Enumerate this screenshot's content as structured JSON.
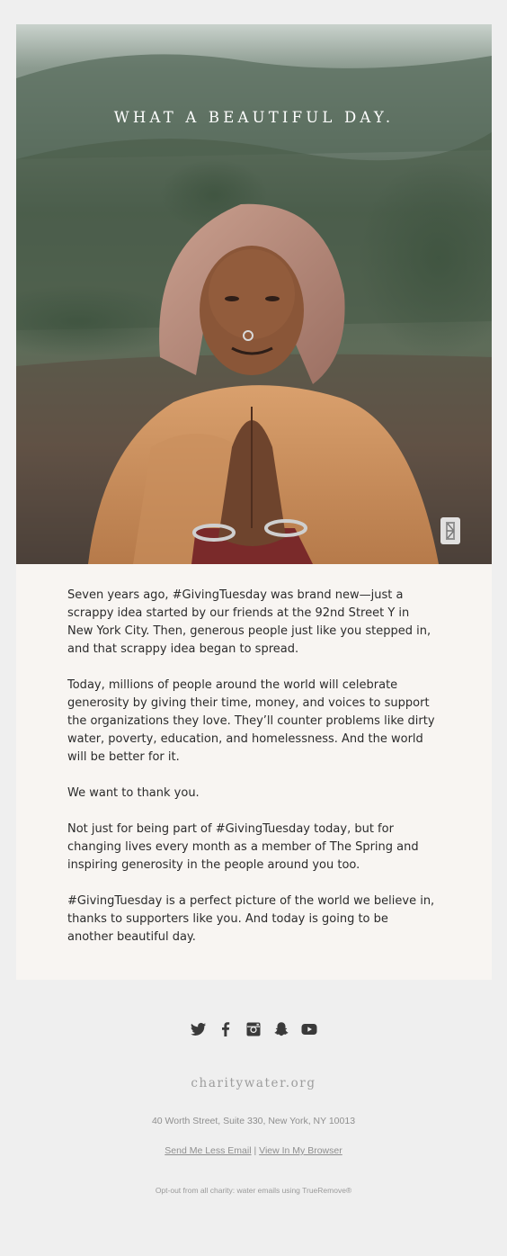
{
  "hero": {
    "title": "WHAT A BEAUTIFUL DAY.",
    "badge_icon": "charity-water-jerrycan-icon"
  },
  "body": {
    "paragraphs": [
      "Seven years ago, #GivingTuesday was brand new—just a scrappy idea started by our friends at the 92nd Street Y in New York City. Then, generous people just like you stepped in, and that scrappy idea began to spread.",
      "Today, millions of people around the world will celebrate generosity by giving their time, money, and voices to support the organizations they love. They’ll counter problems like dirty water, poverty, education, and homelessness. And the world will be better for it.",
      "We want to thank you.",
      "Not just for being part of #GivingTuesday today, but for changing lives every month as a member of The Spring and inspiring generosity in the people around you too.",
      "#GivingTuesday is a perfect picture of the world we believe in, thanks to supporters like you. And today is going to be another beautiful day."
    ]
  },
  "footer": {
    "social_icons": [
      "twitter-icon",
      "facebook-icon",
      "instagram-icon",
      "snapchat-icon",
      "youtube-icon"
    ],
    "brand": "charitywater.org",
    "address": "40 Worth Street, Suite 330, New York, NY 10013",
    "links": {
      "less_email": "Send Me Less Email",
      "separator": "|",
      "view_browser": "View In My Browser"
    },
    "optout": "Opt-out from all charity: water emails using TrueRemove®"
  },
  "colors": {
    "page_background": "#efefef",
    "card_background": "#f8f5f2",
    "body_text": "#2b2b2b",
    "footer_text": "#8f8f8f",
    "icon_color": "#3a3a3a"
  }
}
